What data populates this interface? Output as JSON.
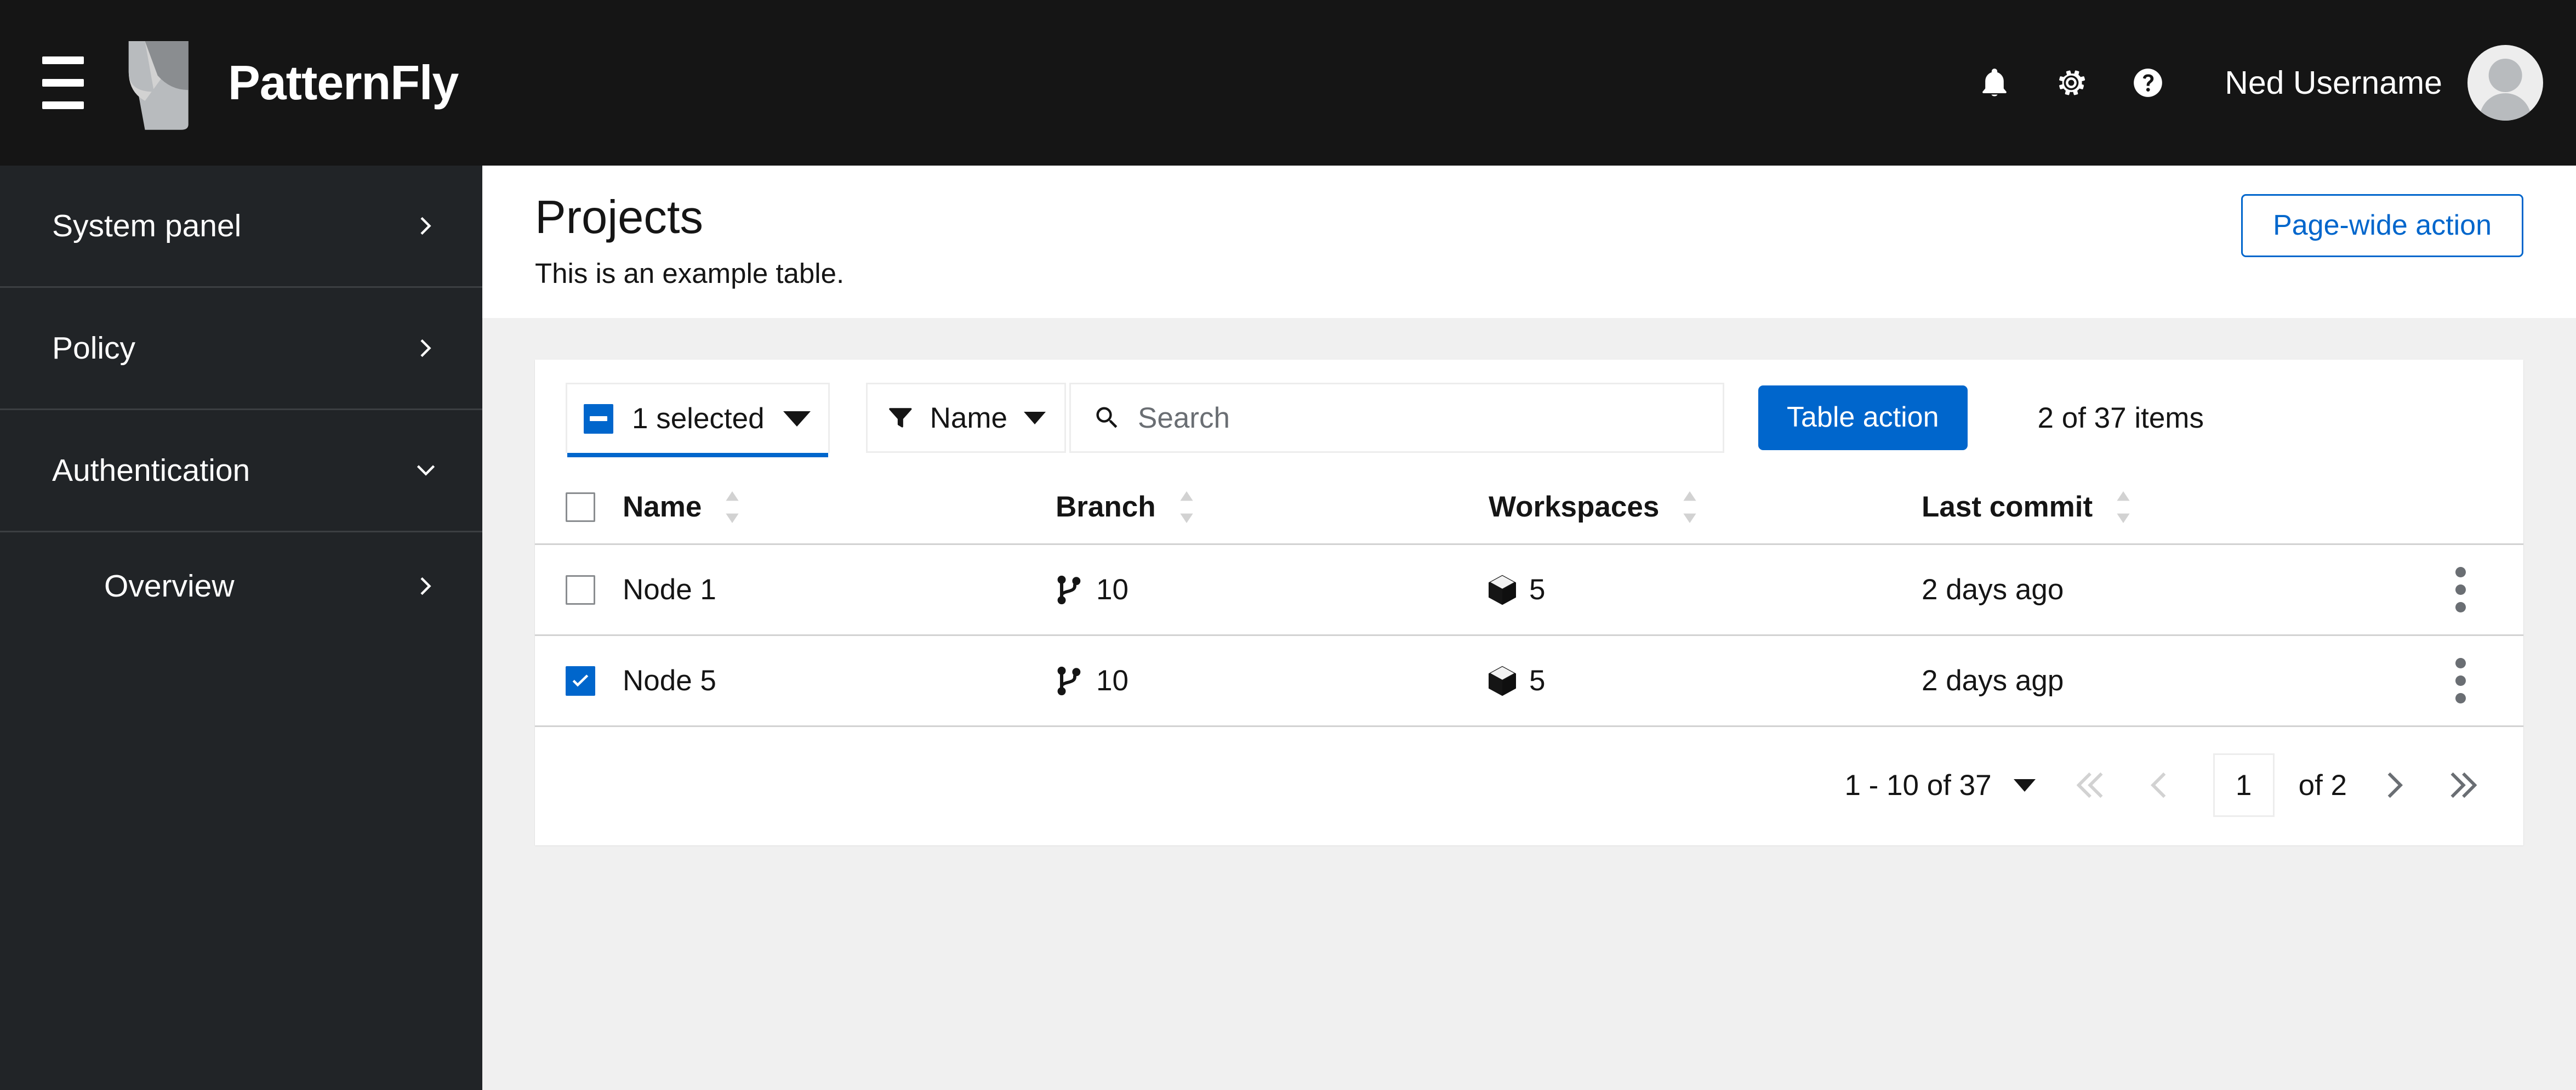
{
  "masthead": {
    "toggle_label": "Global navigation toggle",
    "brand_name": "PatternFly",
    "icons": [
      {
        "name": "notification-bell-icon",
        "label": "Notifications"
      },
      {
        "name": "gear-icon",
        "label": "Settings"
      },
      {
        "name": "help-icon",
        "label": "Help"
      }
    ],
    "username": "Ned Username",
    "avatar_label": "User avatar"
  },
  "sidebar": {
    "items": [
      {
        "label": "System panel",
        "chevron": "chevron-right-icon",
        "expanded": false,
        "sub": false
      },
      {
        "label": "Policy",
        "chevron": "chevron-right-icon",
        "expanded": false,
        "sub": false
      },
      {
        "label": "Authentication",
        "chevron": "chevron-down-icon",
        "expanded": true,
        "sub": false
      },
      {
        "label": "Overview",
        "chevron": "chevron-right-icon",
        "expanded": false,
        "sub": true
      }
    ]
  },
  "page": {
    "title": "Projects",
    "subtitle": "This is an example table.",
    "page_wide_action": "Page-wide action"
  },
  "toolbar": {
    "bulk_select_label": "1 selected",
    "bulk_select_state": "indeterminate",
    "filter_label": "Name",
    "search_placeholder": "Search",
    "search_value": "",
    "table_action_label": "Table action",
    "item_count": "2 of 37 items"
  },
  "table": {
    "columns": [
      {
        "label": "Name",
        "sortable": true
      },
      {
        "label": "Branch",
        "sortable": true
      },
      {
        "label": "Workspaces",
        "sortable": true
      },
      {
        "label": "Last commit",
        "sortable": true
      }
    ],
    "rows": [
      {
        "selected": false,
        "name": "Node 1",
        "branch": "10",
        "workspaces": "5",
        "last_commit": "2 days ago"
      },
      {
        "selected": true,
        "name": "Node 5",
        "branch": "10",
        "workspaces": "5",
        "last_commit": "2 days agp"
      }
    ]
  },
  "pagination": {
    "per_page_label": "1 - 10 of 37",
    "current_page": "1",
    "of_pages": "of 2",
    "first_enabled": false,
    "prev_enabled": false,
    "next_enabled": true,
    "last_enabled": true
  },
  "colors": {
    "masthead_bg": "#151515",
    "sidebar_bg": "#212427",
    "accent_blue": "#0066cc",
    "page_bg": "#f0f0f0",
    "border": "#d2d2d2"
  }
}
